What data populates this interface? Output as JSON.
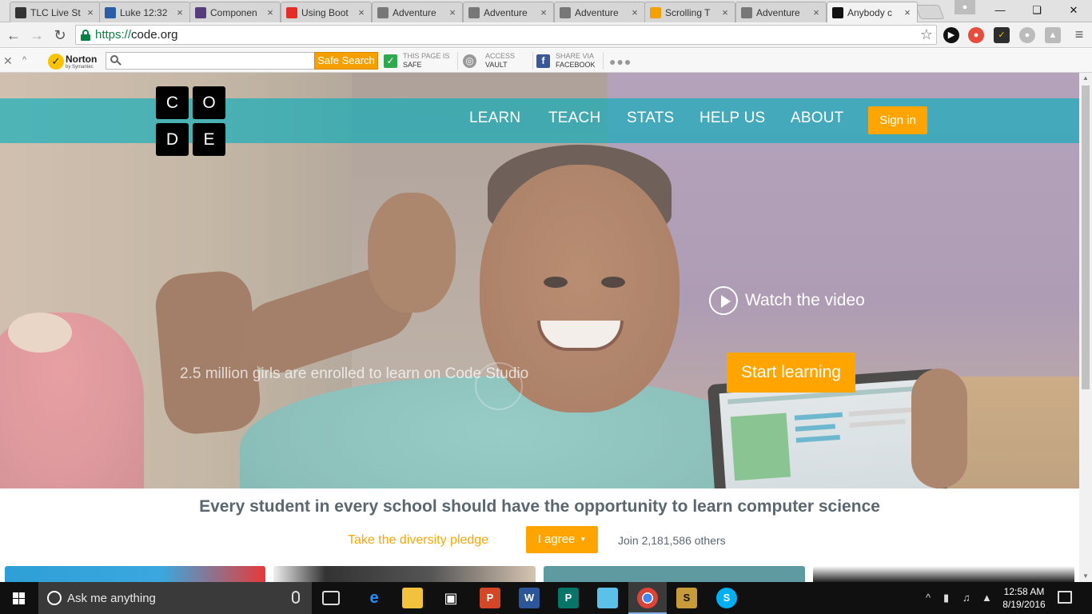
{
  "browser": {
    "tabs": [
      {
        "title": "TLC Live St",
        "icon": "play-circle-icon",
        "color": "#333333"
      },
      {
        "title": "Luke 12:32",
        "icon": "cross-icon",
        "color": "#2a5ca8"
      },
      {
        "title": "Componen",
        "icon": "bootstrap-icon",
        "color": "#563d7c"
      },
      {
        "title": "Using Boot",
        "icon": "youtube-icon",
        "color": "#e52d27"
      },
      {
        "title": "Adventure",
        "icon": "document-icon",
        "color": "#777777"
      },
      {
        "title": "Adventure",
        "icon": "document-icon",
        "color": "#777777"
      },
      {
        "title": "Adventure",
        "icon": "document-icon",
        "color": "#777777"
      },
      {
        "title": "Scrolling T",
        "icon": "search-engine-icon",
        "color": "#f4a100"
      },
      {
        "title": "Adventure",
        "icon": "document-icon",
        "color": "#777777"
      },
      {
        "title": "Anybody c",
        "icon": "codeorg-icon",
        "color": "#111111",
        "active": true
      }
    ],
    "url_scheme": "https://",
    "url_host": "code.org"
  },
  "norton": {
    "brand": "Norton",
    "brand_sub": "by Symantec",
    "search_button": "Safe Search",
    "safe_line1": "THIS PAGE IS",
    "safe_line2": "SAFE",
    "vault_line1": "ACCESS",
    "vault_line2": "VAULT",
    "share_line1": "SHARE VIA",
    "share_line2": "FACEBOOK"
  },
  "site": {
    "logo_letters": [
      "C",
      "O",
      "D",
      "E"
    ],
    "nav": [
      "LEARN",
      "TEACH",
      "STATS",
      "HELP US",
      "ABOUT"
    ],
    "signin": "Sign in",
    "watch_video": "Watch the video",
    "start_learning": "Start learning",
    "hero_caption": "2.5 million girls are enrolled to learn on Code Studio",
    "tagline": "Every student in every school should have the opportunity to learn computer science",
    "pledge": "Take the diversity pledge",
    "agree": "I agree",
    "join": "Join 2,181,586 others",
    "colors": {
      "teal": "#00adbc",
      "orange": "#ffa400",
      "slate": "#5b6770"
    }
  },
  "taskbar": {
    "search_placeholder": "Ask me anything",
    "time": "12:58 AM",
    "date": "8/19/2016"
  }
}
